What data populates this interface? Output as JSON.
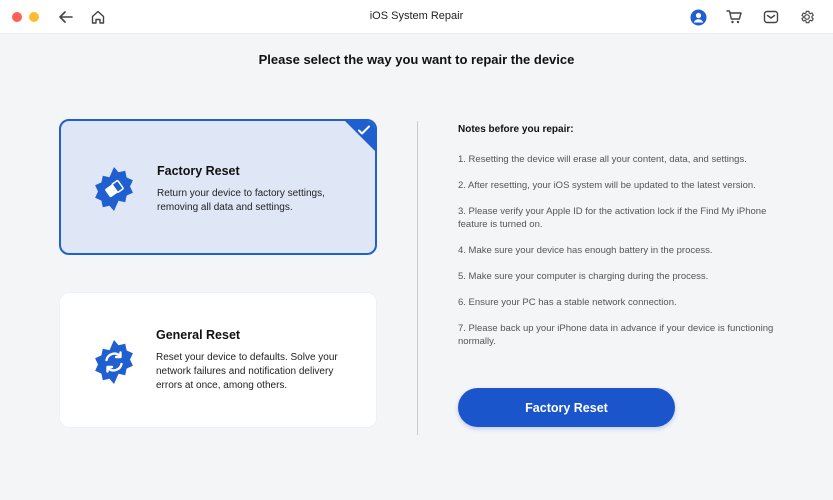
{
  "window": {
    "title": "iOS System Repair"
  },
  "colors": {
    "accent": "#1f5fd0",
    "button": "#1a55cc",
    "selected_bg": "#dfe7f7",
    "traffic_red": "#ff5f57",
    "traffic_yellow": "#febc2e"
  },
  "toolbar": {
    "icons": [
      "back-arrow-icon",
      "home-icon",
      "account-icon",
      "cart-icon",
      "mail-icon",
      "settings-gear-icon"
    ]
  },
  "main": {
    "heading": "Please select the way you want to repair the device",
    "options": [
      {
        "title": "Factory Reset",
        "description": "Return your device to factory settings, removing all data and settings.",
        "selected": true,
        "icon": "gear-eraser-icon"
      },
      {
        "title": "General Reset",
        "description": "Reset your device to defaults. Solve your network failures and notification delivery errors at once, among others.",
        "selected": false,
        "icon": "gear-refresh-icon"
      }
    ]
  },
  "notes": {
    "title": "Notes before you repair:",
    "items": [
      "1. Resetting the device will erase all your content, data, and settings.",
      "2. After resetting, your iOS system will be updated to the latest version.",
      "3. Please verify your Apple ID for the activation lock if the Find My iPhone feature is turned on.",
      "4. Make sure your device has enough battery in the process.",
      "5. Make sure your computer is charging during the process.",
      "6. Ensure your PC has a stable network connection.",
      "7. Please back up your iPhone data in advance if your device is functioning normally."
    ]
  },
  "action": {
    "button_label": "Factory Reset"
  }
}
